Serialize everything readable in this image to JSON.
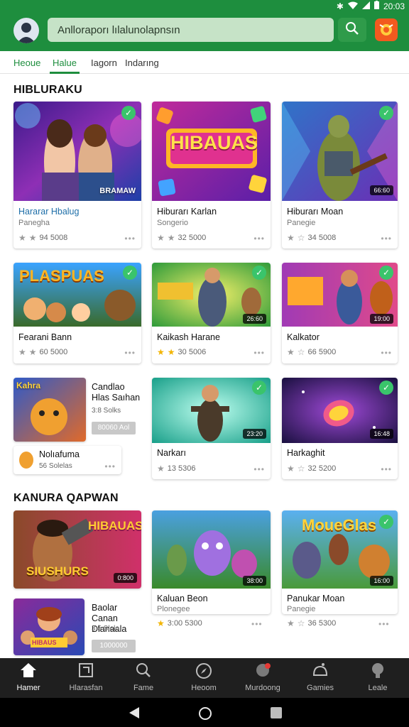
{
  "status_bar": {
    "time": "20:03"
  },
  "header": {
    "search_placeholder": "Anlloraporı lılalunolapnsın"
  },
  "tabs": [
    {
      "label": "Heoue"
    },
    {
      "label": "Halue"
    },
    {
      "label": "Iagorn"
    },
    {
      "label": "Indarıng"
    }
  ],
  "sections": [
    {
      "title": "HIBLURAKU"
    },
    {
      "title": "KANURA QAPWAN"
    }
  ],
  "cards": [
    {
      "title": "Hararar Hbalug",
      "subtitle": "Panegha",
      "meta": "94 5008",
      "art_text": "BRAMAW"
    },
    {
      "title": "Hiburarı Karlan",
      "subtitle": "Songerio",
      "meta": "32 5000",
      "art_text": "HIBAUAS"
    },
    {
      "title": "Hiburarı Moan",
      "subtitle": "Panegie",
      "meta": "34 5008",
      "badge": "66:60"
    },
    {
      "title": "Fearani Bann",
      "meta": "60 5000",
      "art_text": "PLASPUAS"
    },
    {
      "title": "Kaikash Harane",
      "meta": "30 5006",
      "badge": "26:60"
    },
    {
      "title": "Kalkator",
      "meta": "66 5900",
      "badge": "19:00"
    },
    {
      "title": "Narkarı",
      "meta": "13 5306",
      "badge": "23:20"
    },
    {
      "title": "Harkaghit",
      "meta": "32 5200",
      "badge": "16:48"
    },
    {
      "title": "Kaluan Beon",
      "subtitle": "Plonegee",
      "meta": "3:00 5300",
      "badge": "38:00"
    },
    {
      "title": "Panukar Moan",
      "subtitle": "Panegie",
      "meta": "36 5300",
      "art_text": "MoueGlas",
      "badge": "16:00"
    }
  ],
  "mini_cards": [
    {
      "title": "Candlao Hlas Saıhan",
      "sub": "3:8 Solks",
      "pill": "80060 Aol",
      "art_text": "Kahra"
    },
    {
      "title": "Nolıafuma",
      "sub": "56 Solelas"
    },
    {
      "title": "Baolar Canan Dlanaala",
      "sub": "3:5 Slolo",
      "pill": "1000000",
      "art_text": "HIBAUS"
    }
  ],
  "feature_card": {
    "art_text": "HIBAUAS",
    "art_text2": "SIUSHURS",
    "badge": "0:800"
  },
  "bottom_nav": [
    {
      "label": "Hamer"
    },
    {
      "label": "Hlarasfan"
    },
    {
      "label": "Fame"
    },
    {
      "label": "Heoom"
    },
    {
      "label": "Murdoong"
    },
    {
      "label": "Gamies"
    },
    {
      "label": "Leale"
    }
  ]
}
